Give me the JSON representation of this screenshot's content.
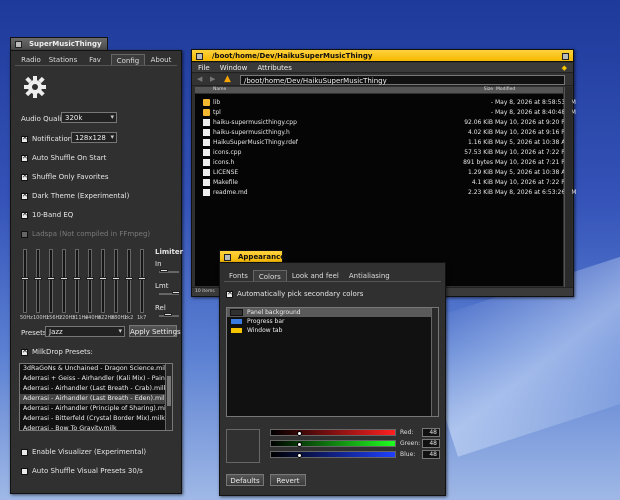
{
  "music": {
    "title": "SuperMusicThingy",
    "tabs": [
      "Radio",
      "Stations",
      "Fav",
      "Config",
      "About"
    ],
    "audio_quality_label": "Audio Quality:",
    "audio_quality_value": "320k",
    "notifications_label": "Notifications",
    "notifications_value": "128x128",
    "options": [
      {
        "label": "Auto Shuffle On Start",
        "checked": true,
        "enabled": true
      },
      {
        "label": "Shuffle Only Favorites",
        "checked": true,
        "enabled": true
      },
      {
        "label": "Dark Theme (Experimental)",
        "checked": true,
        "enabled": true
      },
      {
        "label": "10-Band EQ",
        "checked": true,
        "enabled": true
      },
      {
        "label": "Ladspa (Not compiled in FFmpeg)",
        "checked": false,
        "enabled": false
      }
    ],
    "limiter": {
      "title": "Limiter",
      "in": "In",
      "lmt": "Lmt",
      "rel": "Rel"
    },
    "eq_bands": [
      "50Hz",
      "100Hz",
      "156Hz",
      "220Hz",
      "311Hz",
      "440Hz",
      "622Hz",
      "880Hz",
      "1k2",
      "1k7"
    ],
    "eq_levels": [
      0.45,
      0.45,
      0.45,
      0.45,
      0.45,
      0.45,
      0.45,
      0.45,
      0.45,
      0.45
    ],
    "presets_label": "Presets:",
    "presets_value": "Jazz",
    "apply_button": "Apply Settings",
    "milkdrop_label": "MilkDrop Presets:",
    "milkdrop_items": [
      "3dRaGoNs & Unchained - Dragon Science.milk",
      "Aderrasi + Geiss - Airhandler (Kali Mix) - Painterly Kale",
      "Aderrasi - Airhandler (Last Breath - Crab).milk",
      "Aderrasi - Airhandler (Last Breath - Eden).milk",
      "Aderrasi - Airhandler (Principle of Sharing).milk",
      "Aderrasi - Bitterfeld (Crystal Border Mix).milk",
      "Aderrasi - Bow To Gravity.milk"
    ],
    "milkdrop_selected": 3,
    "visualizer_label": "Enable Visualizer (Experimental)",
    "auto_shuffle_visual_label": "Auto Shuffle Visual Presets 30/s"
  },
  "tracker": {
    "title": "/boot/home/Dev/HaikuSuperMusicThingy",
    "menu": [
      "File",
      "Window",
      "Attributes"
    ],
    "path": "/boot/home/Dev/HaikuSuperMusicThingy",
    "columns": [
      "Name",
      "Size",
      "Modified"
    ],
    "files": [
      {
        "name": "lib",
        "size": "-",
        "modified": "May 8, 2026 at 8:58:53 PM",
        "type": "folder"
      },
      {
        "name": "tpl",
        "size": "-",
        "modified": "May 8, 2026 at 8:40:48 PM",
        "type": "folder"
      },
      {
        "name": "haiku-supermusicthingy.cpp",
        "size": "92.06 KiB",
        "modified": "May 10, 2026 at 9:20 PM",
        "type": "doc"
      },
      {
        "name": "haiku-supermusicthingy.h",
        "size": "4.02 KiB",
        "modified": "May 10, 2026 at 9:16 PM",
        "type": "doc"
      },
      {
        "name": "HaikuSuperMusicThingy.rdef",
        "size": "1.16 KiB",
        "modified": "May 5, 2026 at 10:38 AM",
        "type": "doc"
      },
      {
        "name": "icons.cpp",
        "size": "57.53 KiB",
        "modified": "May 10, 2026 at 7:22 PM",
        "type": "doc"
      },
      {
        "name": "icons.h",
        "size": "891 bytes",
        "modified": "May 10, 2026 at 7:21 PM",
        "type": "doc"
      },
      {
        "name": "LICENSE",
        "size": "1.29 KiB",
        "modified": "May 5, 2026 at 10:38 AM",
        "type": "doc"
      },
      {
        "name": "Makefile",
        "size": "4.1 KiB",
        "modified": "May 10, 2026 at 7:22 PM",
        "type": "doc"
      },
      {
        "name": "readme.md",
        "size": "2.23 KiB",
        "modified": "May 8, 2026 at 6:53:26 AM",
        "type": "doc"
      }
    ],
    "status": "10 items"
  },
  "appearance": {
    "title": "Appearance",
    "tabs": [
      "Fonts",
      "Colors",
      "Look and feel",
      "Antialiasing"
    ],
    "active_tab": 1,
    "auto_pick_label": "Automatically pick secondary colors",
    "color_items": [
      {
        "label": "Panel background",
        "color": "#303030"
      },
      {
        "label": "Progress bar",
        "color": "#3a7be0"
      },
      {
        "label": "Window tab",
        "color": "#f5c400"
      }
    ],
    "red_label": "Red:",
    "red_value": "48",
    "green_label": "Green:",
    "green_value": "48",
    "blue_label": "Blue:",
    "blue_value": "48",
    "defaults_button": "Defaults",
    "revert_button": "Revert"
  }
}
